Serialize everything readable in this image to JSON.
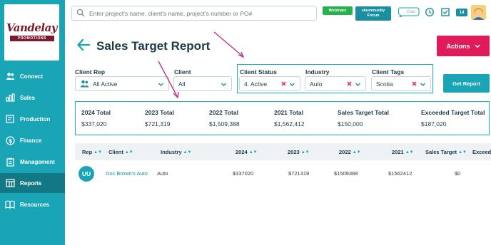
{
  "logo": {
    "name": "Vandelay",
    "tagline": "PROMOTIONS"
  },
  "sidebar": {
    "items": [
      {
        "label": "Connect",
        "icon": "people-icon",
        "active": false
      },
      {
        "label": "Sales",
        "icon": "bar-chart-icon",
        "active": false
      },
      {
        "label": "Production",
        "icon": "production-icon",
        "active": false
      },
      {
        "label": "Finance",
        "icon": "dollar-icon",
        "active": false
      },
      {
        "label": "Management",
        "icon": "clipboard-icon",
        "active": false
      },
      {
        "label": "Reports",
        "icon": "reports-icon",
        "active": true
      },
      {
        "label": "Resources",
        "icon": "book-icon",
        "active": false
      }
    ]
  },
  "topbar": {
    "search_placeholder": "Enter project's name, client's name, project's number or PO#",
    "webinars_label": "Webinars",
    "forum_line1": "skummunity",
    "forum_line2": "Forum",
    "chat_label": "Chat",
    "notification_count": "14"
  },
  "page": {
    "title": "Sales Target Report",
    "actions_label": "Actions"
  },
  "filters": {
    "client_rep": {
      "label": "Client Rep",
      "value": "All Active"
    },
    "client": {
      "label": "Client",
      "value": "All"
    },
    "client_status": {
      "label": "Client Status",
      "value": "4. Active"
    },
    "industry": {
      "label": "Industry",
      "value": "Auto"
    },
    "client_tags": {
      "label": "Client Tags",
      "value": "Scotia"
    },
    "get_report_label": "Get Report"
  },
  "totals": [
    {
      "label": "2024 Total",
      "value": "$337,020"
    },
    {
      "label": "2023 Total",
      "value": "$721,319"
    },
    {
      "label": "2022 Total",
      "value": "$1,509,388"
    },
    {
      "label": "2021 Total",
      "value": "$1,562,412"
    },
    {
      "label": "Sales Target Total",
      "value": "$150,000"
    },
    {
      "label": "Exceeded Target Total",
      "value": "$187,020"
    }
  ],
  "table": {
    "headers": [
      "Rep",
      "Client",
      "Industry",
      "2024",
      "2023",
      "2022",
      "2021",
      "Sales Target",
      "Exceed"
    ],
    "rows": [
      {
        "rep": "UU",
        "client": "Doc Brown's Auto",
        "industry": "Auto",
        "y2024": "$337020",
        "y2023": "$721319",
        "y2022": "$1509388",
        "y2021": "$1562412",
        "target": "$0"
      }
    ]
  },
  "colors": {
    "sidebar": "#1aa5b6",
    "accent": "#e01b5a",
    "highlight": "#19b3c4",
    "annotation": "#c0338a"
  }
}
